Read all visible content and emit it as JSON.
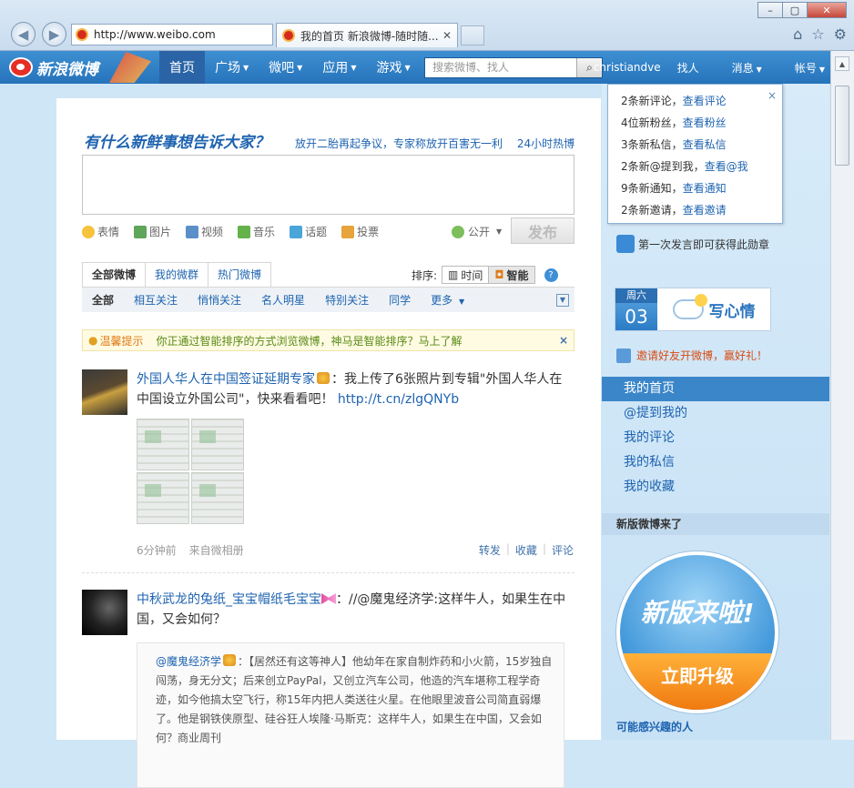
{
  "browser": {
    "address": "http://www.weibo.com",
    "tab_title": "我的首页 新浪微博-随时随...",
    "tab_close": "✕",
    "window_buttons": [
      "–",
      "▢",
      "✕"
    ]
  },
  "nav": {
    "logo_text": "新浪微博",
    "items": [
      "首页",
      "广场",
      "微吧",
      "应用",
      "游戏"
    ],
    "search_placeholder": "搜索微博、找人",
    "user": "christiandve",
    "find": "找人",
    "messages": "消息",
    "account": "帐号"
  },
  "publisher": {
    "prompt": "有什么新鲜事想告诉大家？",
    "hot_topic": "放开二胎再起争议，专家称放开百害无一利",
    "hot24": "24小时热博",
    "tools": [
      "表情",
      "图片",
      "视频",
      "音乐",
      "话题",
      "投票"
    ],
    "visibility": "公开",
    "post_button": "发布"
  },
  "feed_tabs": [
    "全部微博",
    "我的微群",
    "热门微博"
  ],
  "sort": {
    "label": "排序:",
    "time": "时间",
    "smart": "智能",
    "help": "?"
  },
  "sub_tabs": [
    "全部",
    "相互关注",
    "悄悄关注",
    "名人明星",
    "特别关注",
    "同学",
    "更多"
  ],
  "tip": {
    "label": "温馨提示",
    "text": "你正通过智能排序的方式浏览微博，神马是智能排序？马上了解",
    "close": "×"
  },
  "posts": [
    {
      "user": "外国人华人在中国签证延期专家",
      "text": "：我上传了6张照片到专辑\"外国人华人在中国设立外国公司\"，快来看看吧！",
      "link": "http://t.cn/zlgQNYb",
      "time": "6分钟前",
      "source": "来自微相册",
      "actions": [
        "转发",
        "收藏",
        "评论"
      ]
    },
    {
      "user": "中秋武龙的兔纸_宝宝帽纸毛宝宝",
      "text": "：//@魔鬼经济学:这样牛人，如果生在中国，又会如何？",
      "quote_user": "@魔鬼经济学",
      "quote_text": "：【居然还有这等神人】他幼年在家自制炸药和小火箭，15岁独自闯荡，身无分文；后来创立PayPal，又创立汽车公司，他造的汽车堪称工程学奇迹，如今他搞太空飞行，称15年内把人类送往火星。在他眼里波音公司简直弱爆了。他是钢铁侠原型、硅谷狂人埃隆·马斯克：这样牛人，如果生在中国，又会如何？商业周刊"
    }
  ],
  "notifications": [
    {
      "text": "2条新评论，",
      "link": "查看评论"
    },
    {
      "text": "4位新粉丝，",
      "link": "查看粉丝"
    },
    {
      "text": "3条新私信，",
      "link": "查看私信"
    },
    {
      "text": "2条新@提到我，",
      "link": "查看@我"
    },
    {
      "text": "9条新通知，",
      "link": "查看通知"
    },
    {
      "text": "2条新邀请，",
      "link": "查看邀请"
    }
  ],
  "notif_close": "×",
  "sidebar": {
    "badge_text": "第一次发言即可获得此勋章",
    "weekday": "周六",
    "day": "03",
    "mood": "写心情",
    "invite": "邀请好友开微博，赢好礼！",
    "menu": [
      "我的首页",
      "@提到我的",
      "我的评论",
      "我的私信",
      "我的收藏"
    ],
    "new_version_title": "新版微博来了",
    "upgrade_top": "新版来啦!",
    "upgrade_btn": "立即升级",
    "maybe": "可能感兴趣的人"
  }
}
